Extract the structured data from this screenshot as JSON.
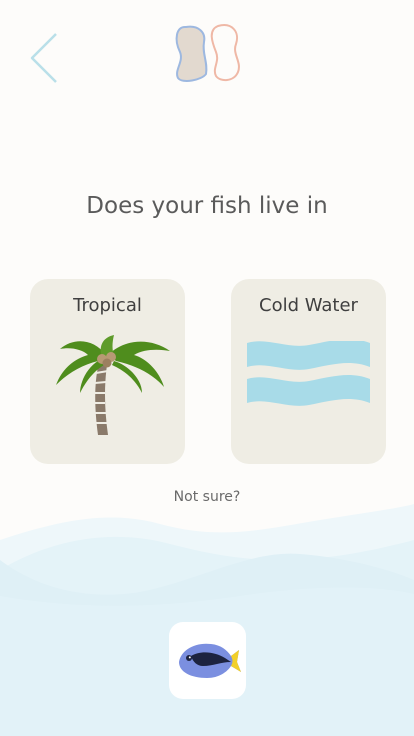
{
  "question": "Does your fish live in",
  "options": [
    {
      "label": "Tropical",
      "icon": "palm-tree-icon"
    },
    {
      "label": "Cold Water",
      "icon": "waves-icon"
    }
  ],
  "not_sure": "Not sure?",
  "colors": {
    "background": "#fdfcfa",
    "card": "#efede4",
    "water": "#a8dbe8",
    "back_chevron": "#b9dfe9"
  },
  "icons": {
    "back": "chevron-left-icon",
    "logo": "fish-fins-logo-icon",
    "fish_button": "blue-tang-fish-icon"
  }
}
